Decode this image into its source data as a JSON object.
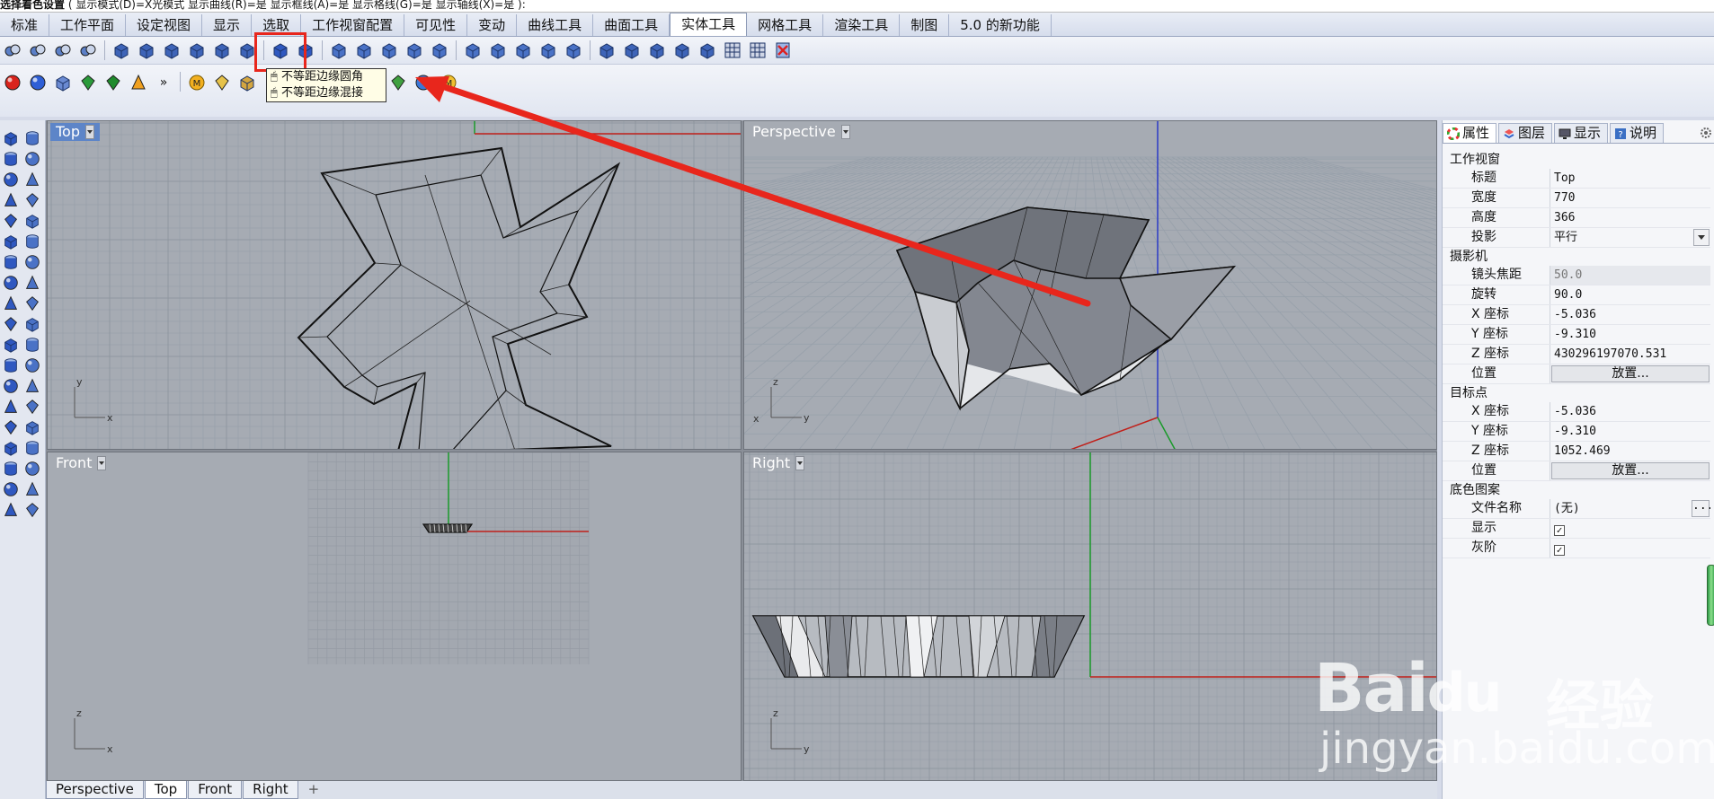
{
  "command_line": {
    "prompt": "选择着色设置",
    "options": "( 显示模式(D)=X光模式  显示曲线(R)=是  显示框线(A)=是  显示格线(G)=是  显示轴线(X)=是 ):"
  },
  "menu_tabs": [
    {
      "label": "标准"
    },
    {
      "label": "工作平面"
    },
    {
      "label": "设定视图"
    },
    {
      "label": "显示"
    },
    {
      "label": "选取"
    },
    {
      "label": "工作视窗配置"
    },
    {
      "label": "可见性"
    },
    {
      "label": "变动"
    },
    {
      "label": "曲线工具"
    },
    {
      "label": "曲面工具"
    },
    {
      "label": "实体工具"
    },
    {
      "label": "网格工具"
    },
    {
      "label": "渲染工具"
    },
    {
      "label": "制图"
    },
    {
      "label": "5.0 的新功能"
    }
  ],
  "active_menu_tab": "实体工具",
  "tooltip": {
    "line1": "不等距边缘圆角",
    "line2": "不等距边缘混接"
  },
  "toolbar2": {
    "more_label": "»"
  },
  "viewports": {
    "top": {
      "label": "Top",
      "axis_x": "x",
      "axis_y": "y"
    },
    "perspective": {
      "label": "Perspective",
      "axis_x": "x",
      "axis_y": "y",
      "axis_z": "z"
    },
    "front": {
      "label": "Front",
      "axis_x": "x",
      "axis_z": "z"
    },
    "right": {
      "label": "Right",
      "axis_y": "y",
      "axis_z": "z"
    }
  },
  "viewport_tabs": [
    {
      "label": "Perspective"
    },
    {
      "label": "Top"
    },
    {
      "label": "Front"
    },
    {
      "label": "Right"
    },
    {
      "label": "+"
    }
  ],
  "active_viewport_tab": "Top",
  "panel": {
    "tabs": [
      {
        "label": "属性",
        "icon": "color-wheel-icon"
      },
      {
        "label": "图层",
        "icon": "layers-icon"
      },
      {
        "label": "显示",
        "icon": "monitor-icon"
      },
      {
        "label": "说明",
        "icon": "help-icon"
      }
    ],
    "sections": {
      "viewport": {
        "title": "工作视窗",
        "rows": [
          {
            "name": "标题",
            "value": "Top"
          },
          {
            "name": "宽度",
            "value": "770"
          },
          {
            "name": "高度",
            "value": "366"
          },
          {
            "name": "投影",
            "value": "平行"
          }
        ]
      },
      "camera": {
        "title": "摄影机",
        "rows": [
          {
            "name": "镜头焦距",
            "value": "50.0"
          },
          {
            "name": "旋转",
            "value": "90.0"
          },
          {
            "name": "X 座标",
            "value": "-5.036"
          },
          {
            "name": "Y 座标",
            "value": "-9.310"
          },
          {
            "name": "Z 座标",
            "value": "430296197070.531"
          },
          {
            "name": "位置",
            "value": "放置..."
          }
        ]
      },
      "target": {
        "title": "目标点",
        "rows": [
          {
            "name": "X 座标",
            "value": "-5.036"
          },
          {
            "name": "Y 座标",
            "value": "-9.310"
          },
          {
            "name": "Z 座标",
            "value": "1052.469"
          },
          {
            "name": "位置",
            "value": "放置..."
          }
        ]
      },
      "wallpaper": {
        "title": "底色图案",
        "rows": [
          {
            "name": "文件名称",
            "value": "(无)"
          },
          {
            "name": "显示",
            "checked": true
          },
          {
            "name": "灰阶",
            "checked": true
          }
        ]
      }
    }
  },
  "watermark": {
    "brand": "Bai",
    "brand2": "du",
    "cn": "经验",
    "url": "jingyan.baidu.com"
  },
  "colors": {
    "highlight": "#e8261c",
    "x_axis": "#c0201a",
    "y_axis": "#1a9a2a",
    "z_axis": "#2a3ac8",
    "viewport_bg": "#a6abb3",
    "active_label": "#5d85c8"
  }
}
